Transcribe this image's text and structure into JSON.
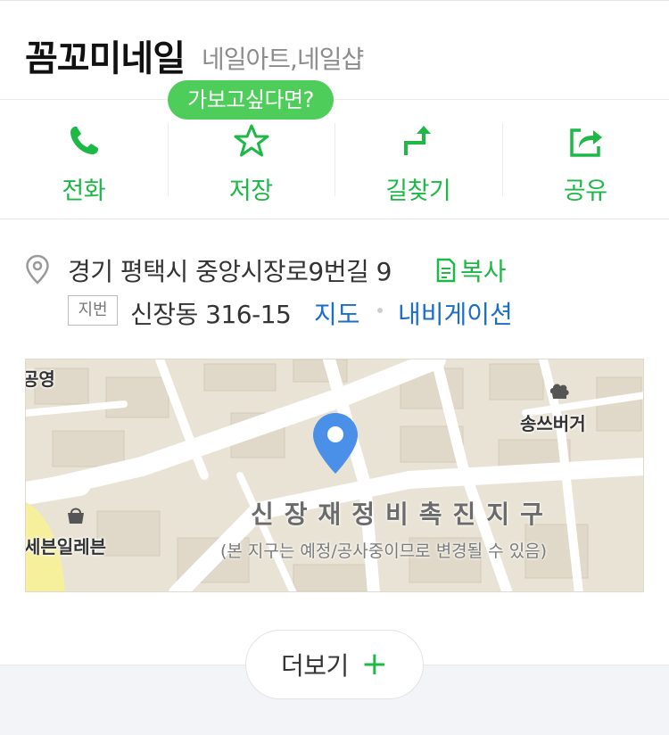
{
  "header": {
    "title": "꼼꼬미네일",
    "category": "네일아트,네일샵"
  },
  "tooltip": {
    "text": "가보고싶다면?"
  },
  "actions": [
    {
      "label": "전화",
      "icon": "phone-icon"
    },
    {
      "label": "저장",
      "icon": "star-icon"
    },
    {
      "label": "길찾기",
      "icon": "directions-icon"
    },
    {
      "label": "공유",
      "icon": "share-icon"
    }
  ],
  "address": {
    "road": "경기 평택시 중앙시장로9번길 9",
    "copy_label": "복사",
    "jibun_badge": "지번",
    "jibun": "신장동 316-15",
    "map_link": "지도",
    "navi_link": "내비게이션"
  },
  "map": {
    "labels": {
      "top_left": "공영",
      "burger": "송쓰버거",
      "seven": "세븐일레븐",
      "district": "신장재정비촉진지구",
      "note": "(본 지구는 예정/공사중이므로 변경될 수 있음)"
    }
  },
  "more": {
    "label": "더보기",
    "plus": "+"
  },
  "colors": {
    "accent_green": "#1db846",
    "tooltip_green": "#4fcd5b",
    "link_blue": "#1a6ec9",
    "marker_blue": "#4a90e8"
  }
}
